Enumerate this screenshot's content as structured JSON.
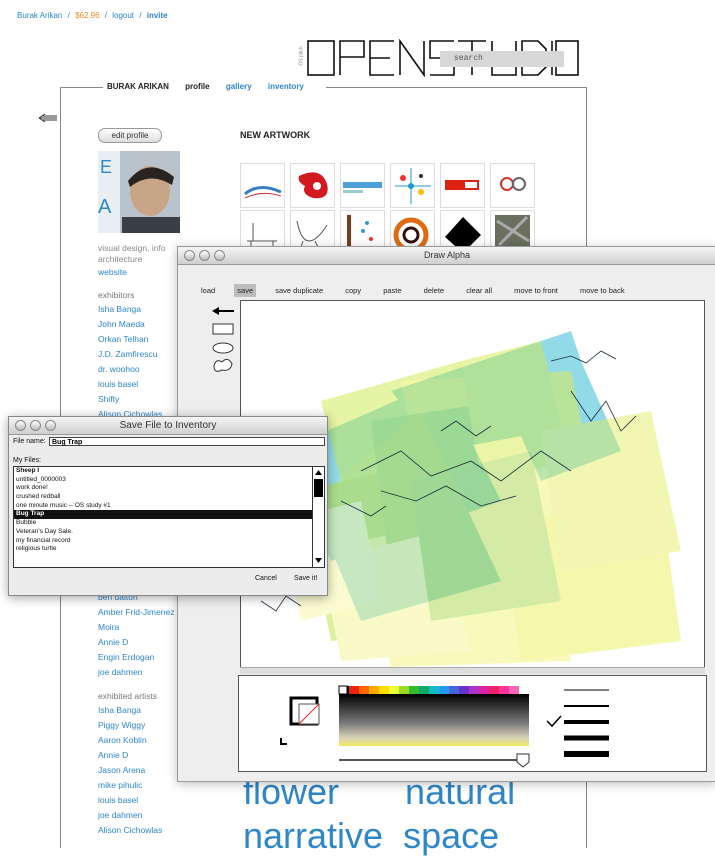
{
  "top_nav": {
    "user": "Burak Arikan",
    "sep1": "/",
    "balance": "$62.96",
    "sep2": "/",
    "logout": "logout",
    "sep3": "/",
    "invite": "invite"
  },
  "logo": {
    "small_text": "OS pitch",
    "text": "OPENSTUDIO"
  },
  "search": {
    "placeholder": "search"
  },
  "profile_nav": {
    "name": "BURAK ARIKAN",
    "profile": "profile",
    "gallery": "gallery",
    "inventory": "inventory"
  },
  "profile": {
    "edit_label": "edit profile",
    "desc_line1": "visual design, info",
    "desc_line2": "architecture",
    "website": "website"
  },
  "exhibitors": {
    "heading": "exhibitors",
    "items": [
      "Isha Banga",
      "John Maeda",
      "Orkan Telhan",
      "J.D. Zamfirescu",
      "dr. woohoo",
      "louis basel",
      "Shifty",
      "Alison Cichowlas"
    ]
  },
  "collectors": {
    "items": [
      "ben dalton",
      "Amber Frid-Jimenez",
      "Moira",
      "Annie D",
      "Engin Erdogan",
      "joe dahmen"
    ]
  },
  "exhibited_artists": {
    "heading": "exhibited artists",
    "items": [
      "Isha Banga",
      "Piggy Wiggy",
      "Aaron Koblin",
      "Annie D",
      "Jason Arena",
      "mike pihulic",
      "louis basel",
      "joe dahmen",
      "Alison Cichowlas"
    ]
  },
  "new_artwork": {
    "heading": "NEW ARTWORK"
  },
  "tag_cloud": {
    "line1": [
      "flower",
      "natural"
    ],
    "line2": [
      "narrative",
      "space"
    ]
  },
  "draw_window": {
    "title": "Draw Alpha",
    "toolbar": [
      "load",
      "save",
      "save duplicate",
      "copy",
      "paste",
      "delete",
      "clear all",
      "move to front",
      "move to back"
    ],
    "active_tool": "save"
  },
  "save_window": {
    "title": "Save File to Inventory",
    "file_name_label": "File name:",
    "file_name_value": "Bug Trap",
    "my_files_label": "My Files:",
    "files": [
      "Sheep I",
      "untitled_0000003",
      "work done!",
      "crushed redball",
      "one minute music -- OS study #1",
      "Bug Trap",
      "Bubble",
      "Veteran's Day Sale.",
      "my financial record",
      "religious turtle"
    ],
    "selected_file": "Bug Trap",
    "cancel_label": "Cancel",
    "save_label": "Save it!"
  },
  "colors": {
    "link": "#2f86c8",
    "money": "#f08a1a",
    "accent_yellow": "#e8ef3a",
    "accent_cyan": "#3bbcd6"
  }
}
